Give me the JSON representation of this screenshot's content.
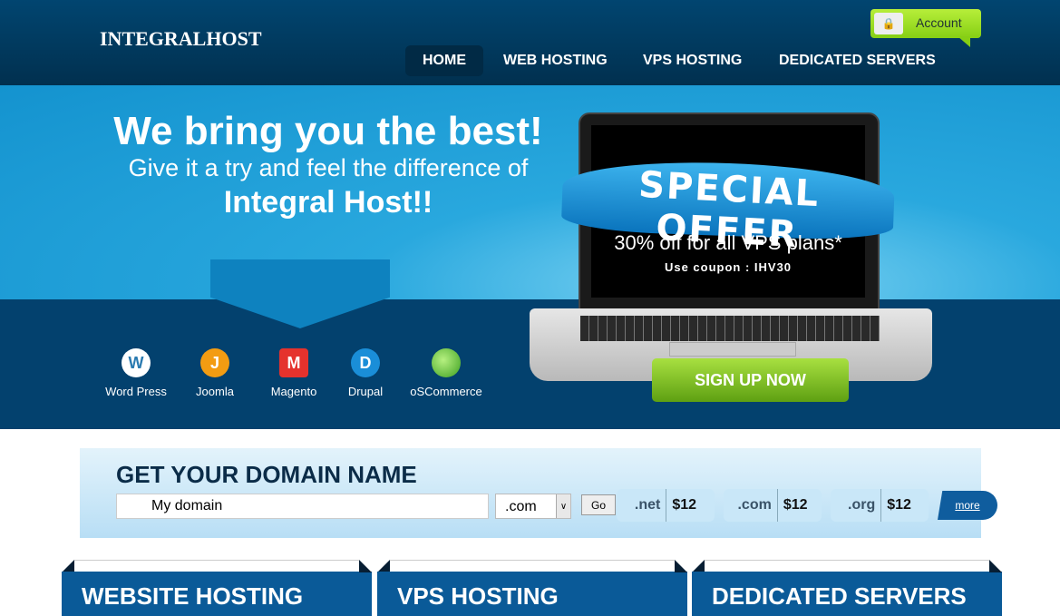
{
  "header": {
    "logo": "INTEGRALHOST",
    "nav": [
      "HOME",
      "WEB HOSTING",
      "VPS HOSTING",
      "DEDICATED SERVERS"
    ],
    "active": "HOME",
    "account": "Account"
  },
  "hero": {
    "headline": "We bring you the best!",
    "subline": "Give it a try and feel the difference of",
    "brand": "Integral Host!!",
    "cms": [
      {
        "label": "Word Press",
        "icon": "wordpress-icon",
        "color": "#2a7ab0"
      },
      {
        "label": "Joomla",
        "icon": "joomla-icon",
        "color": "#f39c12"
      },
      {
        "label": "Magento",
        "icon": "magento-icon",
        "color": "#e5322d"
      },
      {
        "label": "Drupal",
        "icon": "drupal-icon",
        "color": "#1a8ed8"
      },
      {
        "label": "oSCommerce",
        "icon": "oscommerce-icon",
        "color": "#5fcf3a"
      }
    ],
    "offer_title": "SPECIAL OFFER",
    "offer_text": "30% off for all VPS plans*",
    "coupon": "Use coupon : IHV30",
    "signup": "SIGN UP NOW"
  },
  "domain": {
    "title": "GET YOUR DOMAIN NAME",
    "input_value": "My domain",
    "tld_selected": ".com",
    "go": "Go",
    "prices": [
      {
        "tld": ".net",
        "price": "$12"
      },
      {
        "tld": ".com",
        "price": "$12"
      },
      {
        "tld": ".org",
        "price": "$12"
      }
    ],
    "more": "more"
  },
  "cards": [
    "WEBSITE HOSTING",
    "VPS HOSTING",
    "DEDICATED SERVERS"
  ]
}
